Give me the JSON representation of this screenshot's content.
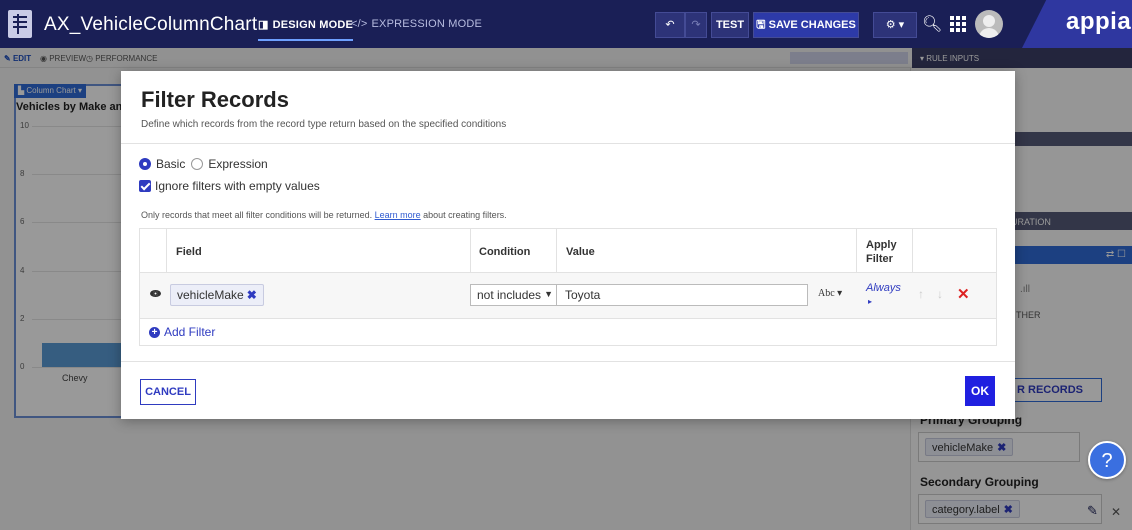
{
  "topbar": {
    "app_title": "AX_VehicleColumnChart",
    "design_mode": "DESIGN MODE",
    "expression_mode": "EXPRESSION MODE",
    "undo": "↶",
    "redo": "↷",
    "test": "TEST",
    "save_changes": "SAVE CHANGES",
    "gear": "⚙ ▾",
    "brand": "appian"
  },
  "subbar": {
    "edit": "EDIT",
    "preview": "PREVIEW",
    "performance": "PERFORMANCE",
    "rule_inputs": "▾ RULE INPUTS"
  },
  "background": {
    "component_tag": "Column Chart",
    "chart_title": "Vehicles by Make an",
    "y_ticks": [
      "10",
      "8",
      "6",
      "4",
      "2",
      "0"
    ],
    "category": "Chevy",
    "right_panel_header": "GURATION",
    "right_panel_other": "THER",
    "right_panel_records": "R RECORDS",
    "primary_grouping_label": "Primary Grouping",
    "primary_grouping_value": "vehicleMake",
    "secondary_grouping_label": "Secondary Grouping",
    "secondary_grouping_value": "category.label",
    "help": "?"
  },
  "chart_data": {
    "type": "bar",
    "categories": [
      "Chevy"
    ],
    "values": [
      1
    ],
    "title": "Vehicles by Make an",
    "ylim": [
      0,
      10
    ],
    "y_ticks": [
      0,
      2,
      4,
      6,
      8,
      10
    ]
  },
  "modal": {
    "title": "Filter Records",
    "description": "Define which records from the record type return based on the specified conditions",
    "radio_basic": "Basic",
    "radio_expression": "Expression",
    "checkbox_ignore": "Ignore filters with empty values",
    "info_prefix": "Only records that meet all filter conditions will be returned. ",
    "info_link": "Learn more",
    "info_suffix": " about creating filters.",
    "columns": {
      "field": "Field",
      "condition": "Condition",
      "value": "Value",
      "apply_filter": "Apply Filter"
    },
    "rows": [
      {
        "field": "vehicleMake",
        "condition": "not includes",
        "value": "Toyota",
        "type_toggle": "Abc ▾",
        "apply": "Always"
      }
    ],
    "add_filter": "Add Filter",
    "cancel": "CANCEL",
    "ok": "OK"
  }
}
